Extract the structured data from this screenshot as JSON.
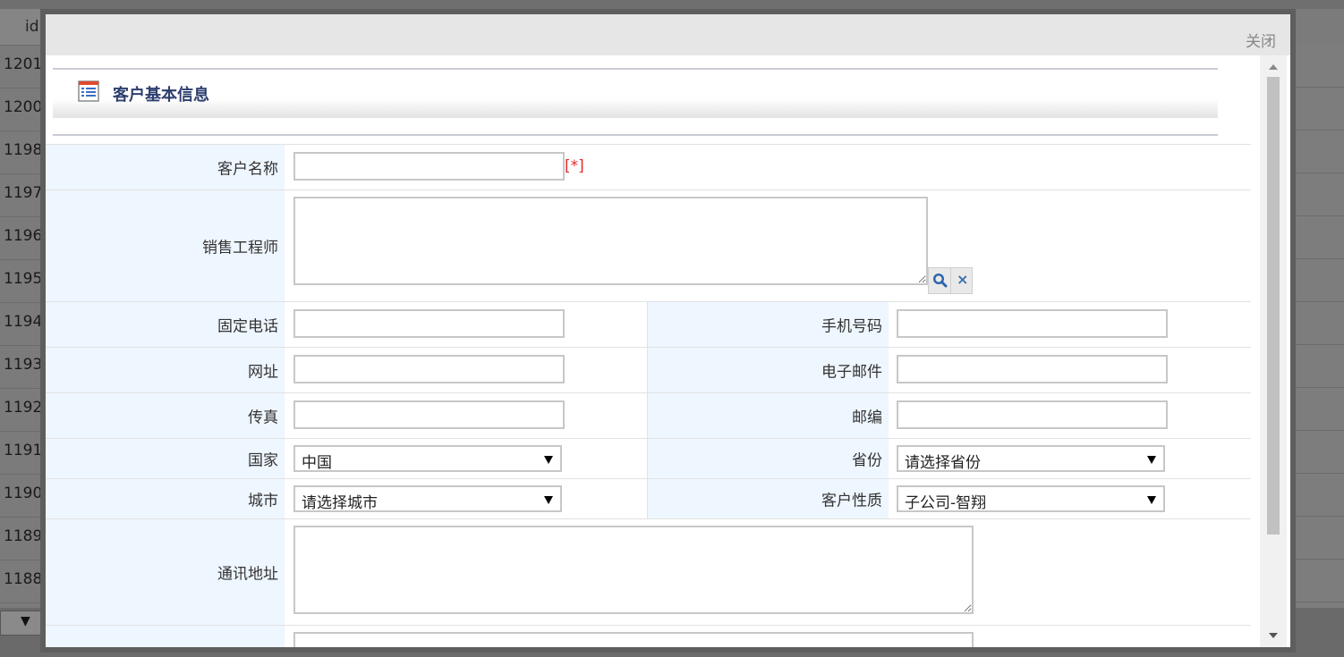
{
  "background": {
    "header_id": "id",
    "row_ids": [
      "1201",
      "1200",
      "1198",
      "1197",
      "1196",
      "1195",
      "1194",
      "1193",
      "1192",
      "1191",
      "1190",
      "1189",
      "1188"
    ],
    "pager_arrow": "▼"
  },
  "dialog": {
    "close_label": "关闭",
    "section_title": "客户基本信息",
    "fields": {
      "customer_name": {
        "label": "客户名称",
        "value": "",
        "required_mark": "[*]"
      },
      "sales_engineer": {
        "label": "销售工程师",
        "value": ""
      },
      "landline": {
        "label": "固定电话",
        "value": ""
      },
      "mobile": {
        "label": "手机号码",
        "value": ""
      },
      "website": {
        "label": "网址",
        "value": ""
      },
      "email": {
        "label": "电子邮件",
        "value": ""
      },
      "fax": {
        "label": "传真",
        "value": ""
      },
      "postcode": {
        "label": "邮编",
        "value": ""
      },
      "country": {
        "label": "国家",
        "selected": "中国"
      },
      "province": {
        "label": "省份",
        "selected": "请选择省份"
      },
      "city": {
        "label": "城市",
        "selected": "请选择城市"
      },
      "customer_type": {
        "label": "客户性质",
        "selected": "子公司-智翔"
      },
      "address": {
        "label": "通讯地址",
        "value": ""
      }
    }
  },
  "icons": {
    "search": "search-icon",
    "clear": "clear-icon",
    "section": "list-icon"
  },
  "colors": {
    "label_bg": "#eef6ff",
    "section_title": "#2d3f6e",
    "required": "#e32b2b",
    "overlay": "#7b7b7b"
  }
}
